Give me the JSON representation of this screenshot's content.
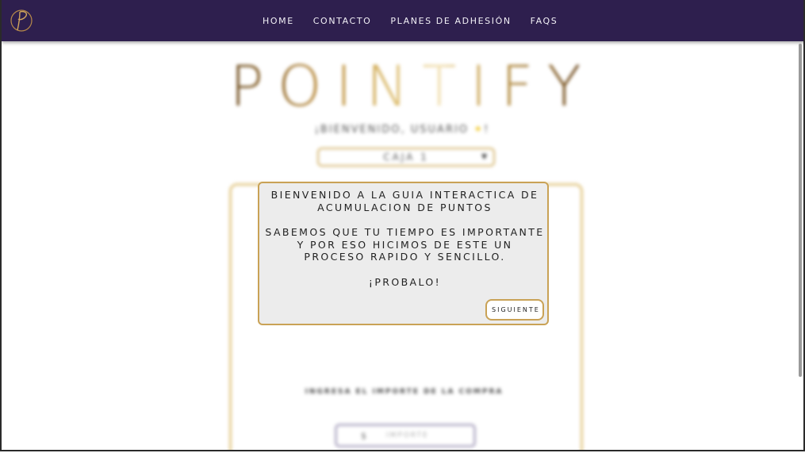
{
  "nav": {
    "links": [
      "HOME",
      "CONTACTO",
      "PLANES DE ADHESIÓN",
      "FAQS"
    ]
  },
  "page": {
    "brand": "POINTIFY",
    "welcome": "¡BIENVENIDO, USUARIO",
    "welcome_end": "!",
    "register_selected": "CAJA 1",
    "amount_label": "INGRESA EL IMPORTE DE LA COMPRA",
    "currency_symbol": "$",
    "amount_placeholder": "IMPORTE"
  },
  "guide": {
    "line1": "BIENVENIDO A LA GUIA INTERACTICA DE ACUMULACION DE PUNTOS",
    "line2": "SABEMOS QUE TU TIEMPO ES IMPORTANTE Y POR ESO HICIMOS DE ESTE UN PROCESO RAPIDO Y SENCILLO.",
    "line3": "¡PROBALO!",
    "next_label": "SIGUIENTE"
  },
  "colors": {
    "navbar": "#2e1f4e",
    "gold": "#c9a256",
    "popup_bg": "#ececec"
  }
}
